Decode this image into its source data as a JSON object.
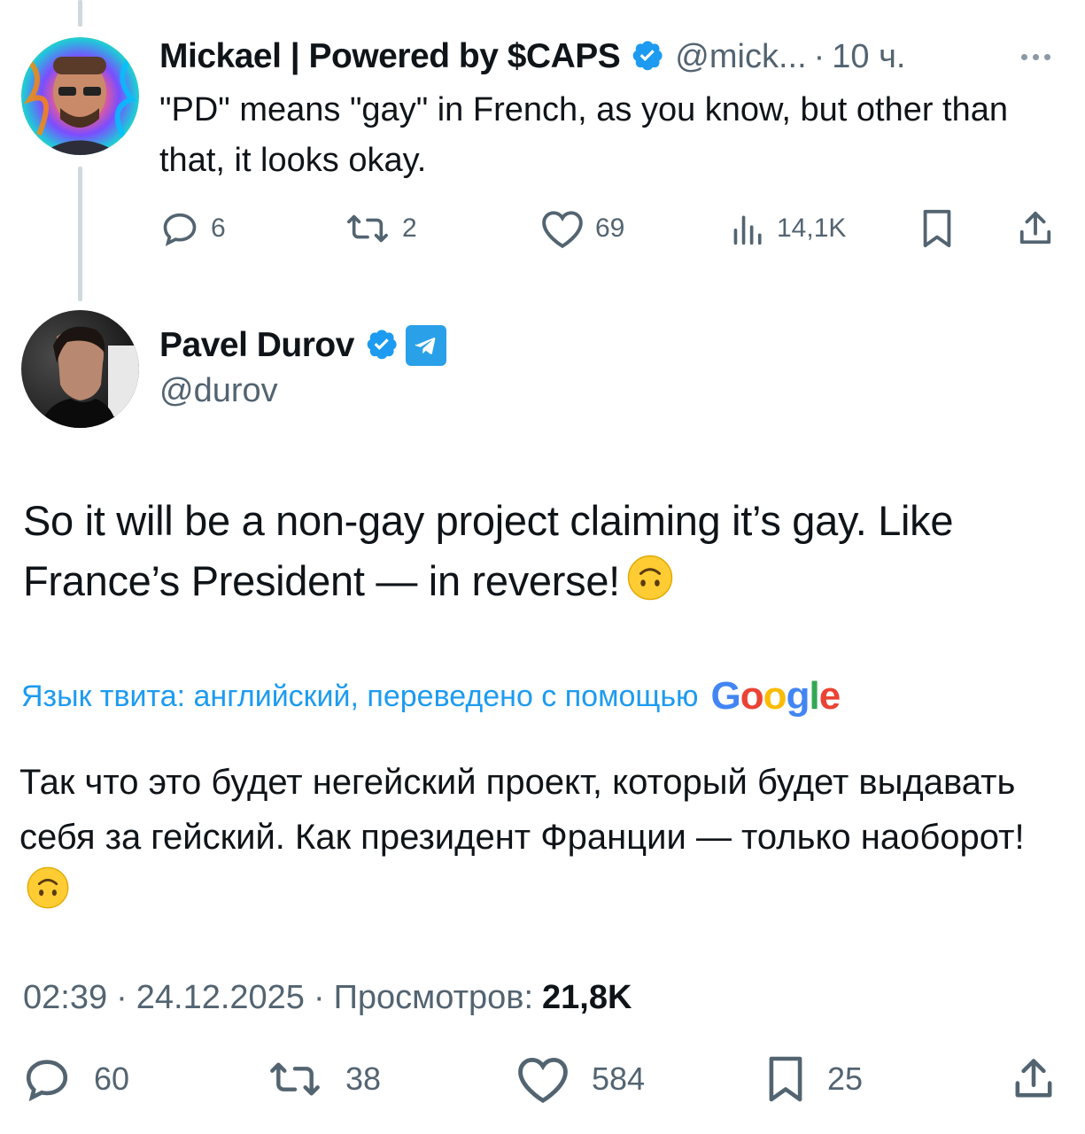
{
  "reply": {
    "author_name": "Mickael | Powered by $CAPS",
    "handle": "@mick...",
    "separator": "·",
    "time": "10 ч.",
    "text": "\"PD\" means \"gay\" in French, as you know, but other than that, it looks okay.",
    "actions": {
      "replies": "6",
      "reposts": "2",
      "likes": "69",
      "views": "14,1K"
    }
  },
  "tweet": {
    "author_name": "Pavel Durov",
    "handle": "@durov",
    "text": "So it will be a non-gay project claiming it’s gay. Like France’s President — in reverse!",
    "translation_note": "Язык твита: английский, переведено с помощью",
    "translation_provider": "Google",
    "translated_text": "Так что это будет негейский проект, который будет выдавать себя за гейский. Как президент Франции — только наоборот!",
    "time": "02:39",
    "date": "24.12.2025",
    "views_label": "Просмотров:",
    "views_count": "21,8K",
    "meta_separator": "·",
    "actions": {
      "replies": "60",
      "reposts": "38",
      "likes": "584",
      "bookmarks": "25"
    }
  },
  "colors": {
    "text": "#0f1419",
    "secondary": "#536471",
    "link": "#1d9bf0",
    "verified": "#1d9bf0",
    "telegram": "#2aa0e8",
    "thread_line": "#cfd9de"
  },
  "icons": [
    "reply-icon",
    "repost-icon",
    "like-icon",
    "views-icon",
    "bookmark-icon",
    "share-icon",
    "verified-badge-icon",
    "telegram-icon",
    "more-icon",
    "upside-down-face-emoji"
  ]
}
